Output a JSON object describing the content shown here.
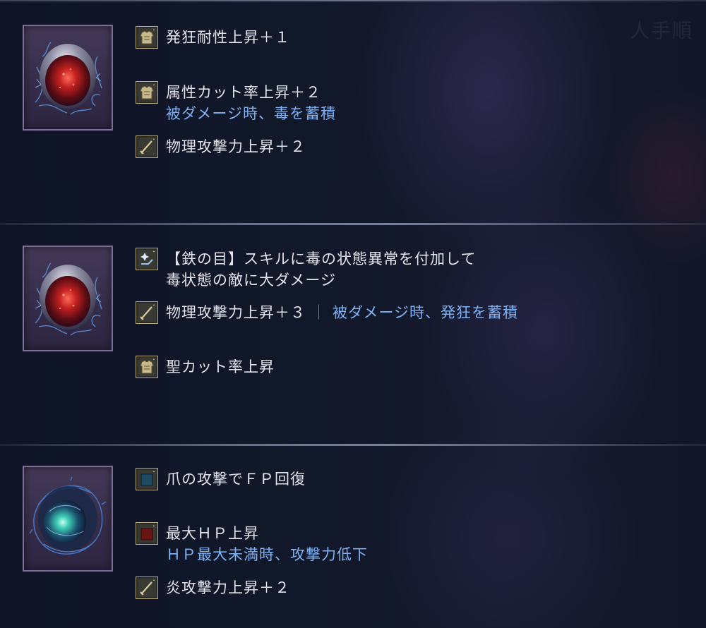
{
  "background_title": "人手順",
  "accent_blue": "#7eb1f3",
  "text_white": "#e4e4ea",
  "sections": [
    {
      "item_icon": "crimson-relic-icon",
      "effects": [
        {
          "icon": "armor-icon",
          "text": "発狂耐性上昇＋１",
          "sub": ""
        },
        {
          "icon": "armor-icon",
          "text": "属性カット率上昇＋２",
          "sub": "被ダメージ時、毒を蓄積"
        },
        {
          "icon": "sword-icon",
          "text": "物理攻撃力上昇＋２",
          "sub": ""
        }
      ]
    },
    {
      "item_icon": "crimson-relic-icon",
      "effects": [
        {
          "icon": "skill-icon",
          "text": "【鉄の目】スキルに毒の状態異常を付加して",
          "sub": "毒状態の敵に大ダメージ"
        },
        {
          "icon": "sword-icon",
          "text": "物理攻撃力上昇＋３",
          "separator": "｜",
          "inline_blue": "被ダメージ時、発狂を蓄積"
        },
        {
          "icon": "armor-icon",
          "text": "聖カット率上昇",
          "sub": ""
        }
      ]
    },
    {
      "item_icon": "teal-relic-icon",
      "effects": [
        {
          "icon": "blue-square-icon",
          "text": "爪の攻撃でＦＰ回復",
          "sub": ""
        },
        {
          "icon": "red-square-icon",
          "text": "最大ＨＰ上昇",
          "sub": "ＨＰ最大未満時、攻撃力低下"
        },
        {
          "icon": "sword-icon",
          "text": "炎攻撃力上昇＋２",
          "sub": ""
        }
      ]
    }
  ]
}
